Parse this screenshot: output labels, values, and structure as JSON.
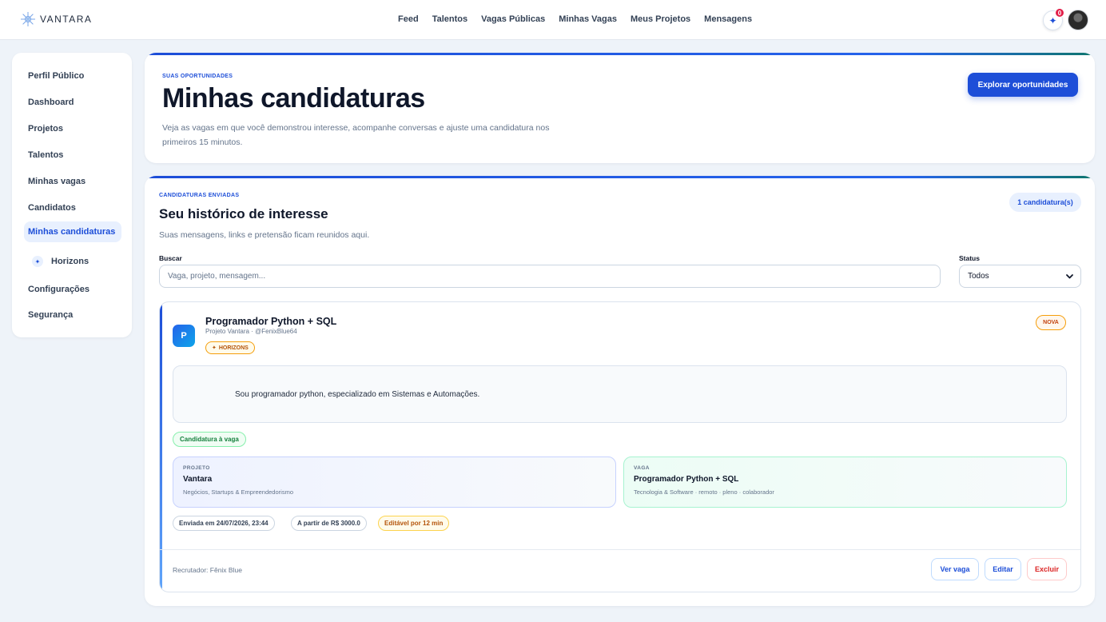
{
  "brand": {
    "name": "VANTARA"
  },
  "nav": {
    "items": [
      "Feed",
      "Talentos",
      "Vagas Públicas",
      "Minhas Vagas",
      "Meus Projetos",
      "Mensagens"
    ],
    "notification_count": "0",
    "sparkle_icon": "✦"
  },
  "sidebar": {
    "items": [
      {
        "label": "Perfil Público"
      },
      {
        "label": "Dashboard"
      },
      {
        "label": "Projetos"
      },
      {
        "label": "Talentos"
      },
      {
        "label": "Minhas vagas"
      },
      {
        "label": "Candidatos"
      },
      {
        "label": "Minhas candidaturas",
        "active": true
      },
      {
        "label": "Horizons",
        "icon": "✦"
      },
      {
        "label": "Configurações"
      },
      {
        "label": "Segurança"
      }
    ]
  },
  "hero": {
    "eyebrow": "SUAS OPORTUNIDADES",
    "title": "Minhas candidaturas",
    "description": "Veja as vagas em que você demonstrou interesse, acompanhe conversas e ajuste uma candidatura nos primeiros 15 minutos.",
    "cta_label": "Explorar oportunidades"
  },
  "history": {
    "eyebrow": "CANDIDATURAS ENVIADAS",
    "title": "Seu histórico de interesse",
    "description": "Suas mensagens, links e pretensão ficam reunidos aqui.",
    "count_label": "1 candidatura(s)",
    "search": {
      "label": "Buscar",
      "placeholder": "Vaga, projeto, mensagem..."
    },
    "status": {
      "label": "Status",
      "selected": "Todos"
    }
  },
  "application": {
    "icon_letter": "P",
    "title": "Programador Python + SQL",
    "subtitle": "Projeto Vantara · @FenixBlue64",
    "horizons_badge": "HORIZONS",
    "horizons_icon": "✦",
    "status_badge": "NOVA",
    "message": "Sou programador python, especializado em Sistemas e Automações.",
    "type_badge": "Candidatura à vaga",
    "project": {
      "label": "PROJETO",
      "name": "Vantara",
      "meta": "Negócios, Startups & Empreendedorismo"
    },
    "job": {
      "label": "VAGA",
      "name": "Programador Python + SQL",
      "meta": "Tecnologia & Software · remoto · pleno · colaborador"
    },
    "sent_at": "Enviada em 24/07/2026, 23:44",
    "salary": "A partir de R$ 3000.0",
    "editable": "Editável por 12 min",
    "recruiter": "Recrutador: Fênix Blue",
    "actions": {
      "view": "Ver vaga",
      "edit": "Editar",
      "delete": "Excluir"
    }
  },
  "colors": {
    "accent": "#1d4ed8",
    "background": "#eef3f9",
    "danger": "#dc2626",
    "success": "#15803d",
    "warning": "#b45309"
  }
}
